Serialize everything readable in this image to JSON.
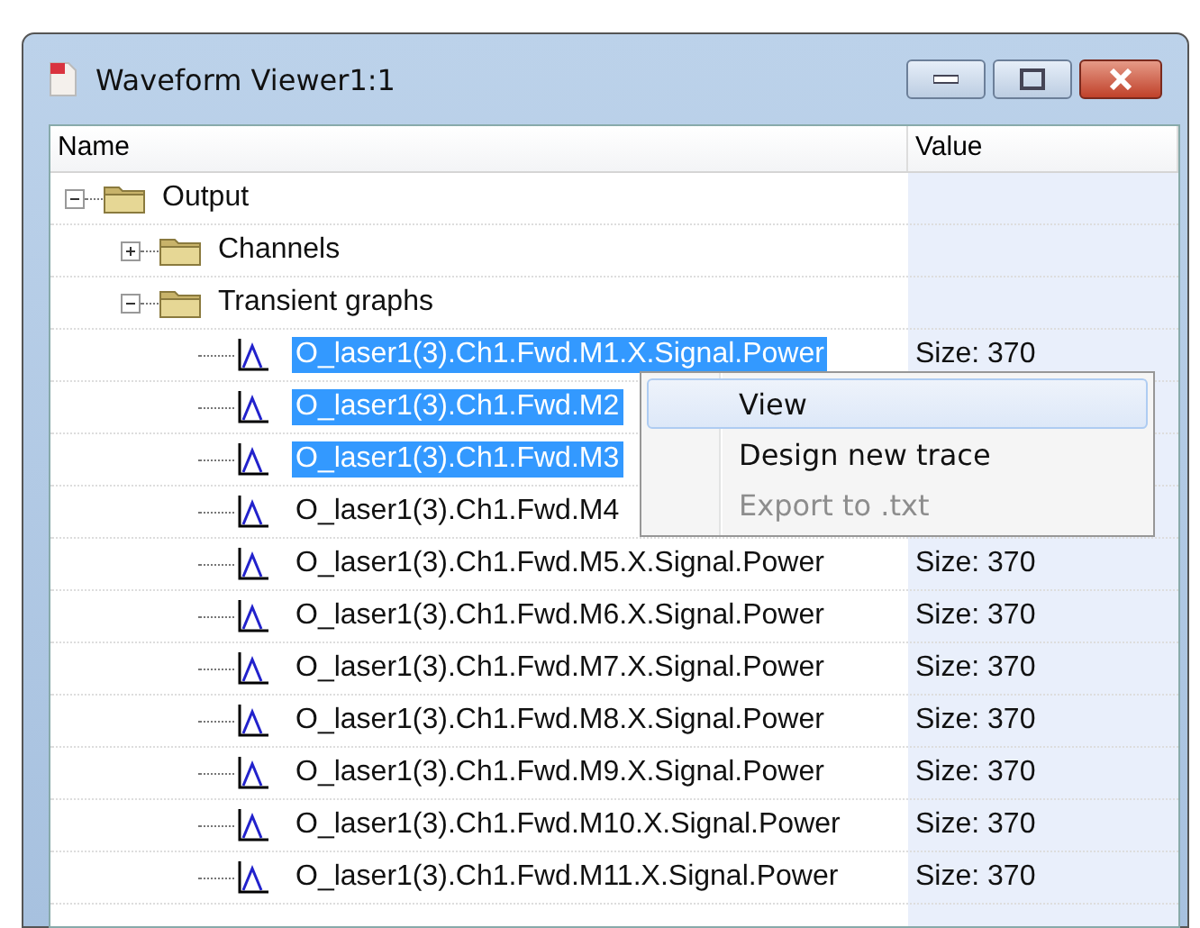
{
  "window": {
    "title": "Waveform Viewer1:1"
  },
  "columns": [
    "Name",
    "Value"
  ],
  "tree": [
    {
      "kind": "folder",
      "label": "Output",
      "expanded": true,
      "children": [
        {
          "kind": "folder",
          "label": "Channels",
          "expanded": false
        },
        {
          "kind": "folder",
          "label": "Transient graphs",
          "expanded": true,
          "children": [
            {
              "kind": "graph",
              "label": "O_laser1(3).Ch1.Fwd.M1.X.Signal.Power",
              "value": "Size: 370",
              "selected": true
            },
            {
              "kind": "graph",
              "label": "O_laser1(3).Ch1.Fwd.M2",
              "selected": true
            },
            {
              "kind": "graph",
              "label": "O_laser1(3).Ch1.Fwd.M3",
              "selected": true
            },
            {
              "kind": "graph",
              "label": "O_laser1(3).Ch1.Fwd.M4",
              "selected": false
            },
            {
              "kind": "graph",
              "label": "O_laser1(3).Ch1.Fwd.M5.X.Signal.Power",
              "value": "Size: 370",
              "selected": false
            },
            {
              "kind": "graph",
              "label": "O_laser1(3).Ch1.Fwd.M6.X.Signal.Power",
              "value": "Size: 370",
              "selected": false
            },
            {
              "kind": "graph",
              "label": "O_laser1(3).Ch1.Fwd.M7.X.Signal.Power",
              "value": "Size: 370",
              "selected": false
            },
            {
              "kind": "graph",
              "label": "O_laser1(3).Ch1.Fwd.M8.X.Signal.Power",
              "value": "Size: 370",
              "selected": false
            },
            {
              "kind": "graph",
              "label": "O_laser1(3).Ch1.Fwd.M9.X.Signal.Power",
              "value": "Size: 370",
              "selected": false
            },
            {
              "kind": "graph",
              "label": "O_laser1(3).Ch1.Fwd.M10.X.Signal.Power",
              "value": "Size: 370",
              "selected": false
            },
            {
              "kind": "graph",
              "label": "O_laser1(3).Ch1.Fwd.M11.X.Signal.Power",
              "value": "Size: 370",
              "selected": false
            }
          ]
        }
      ]
    }
  ],
  "context_menu": [
    {
      "label": "View",
      "selected": true,
      "disabled": false
    },
    {
      "label": "Design new trace",
      "selected": false,
      "disabled": false
    },
    {
      "label": "Export to .txt",
      "selected": false,
      "disabled": true
    }
  ]
}
